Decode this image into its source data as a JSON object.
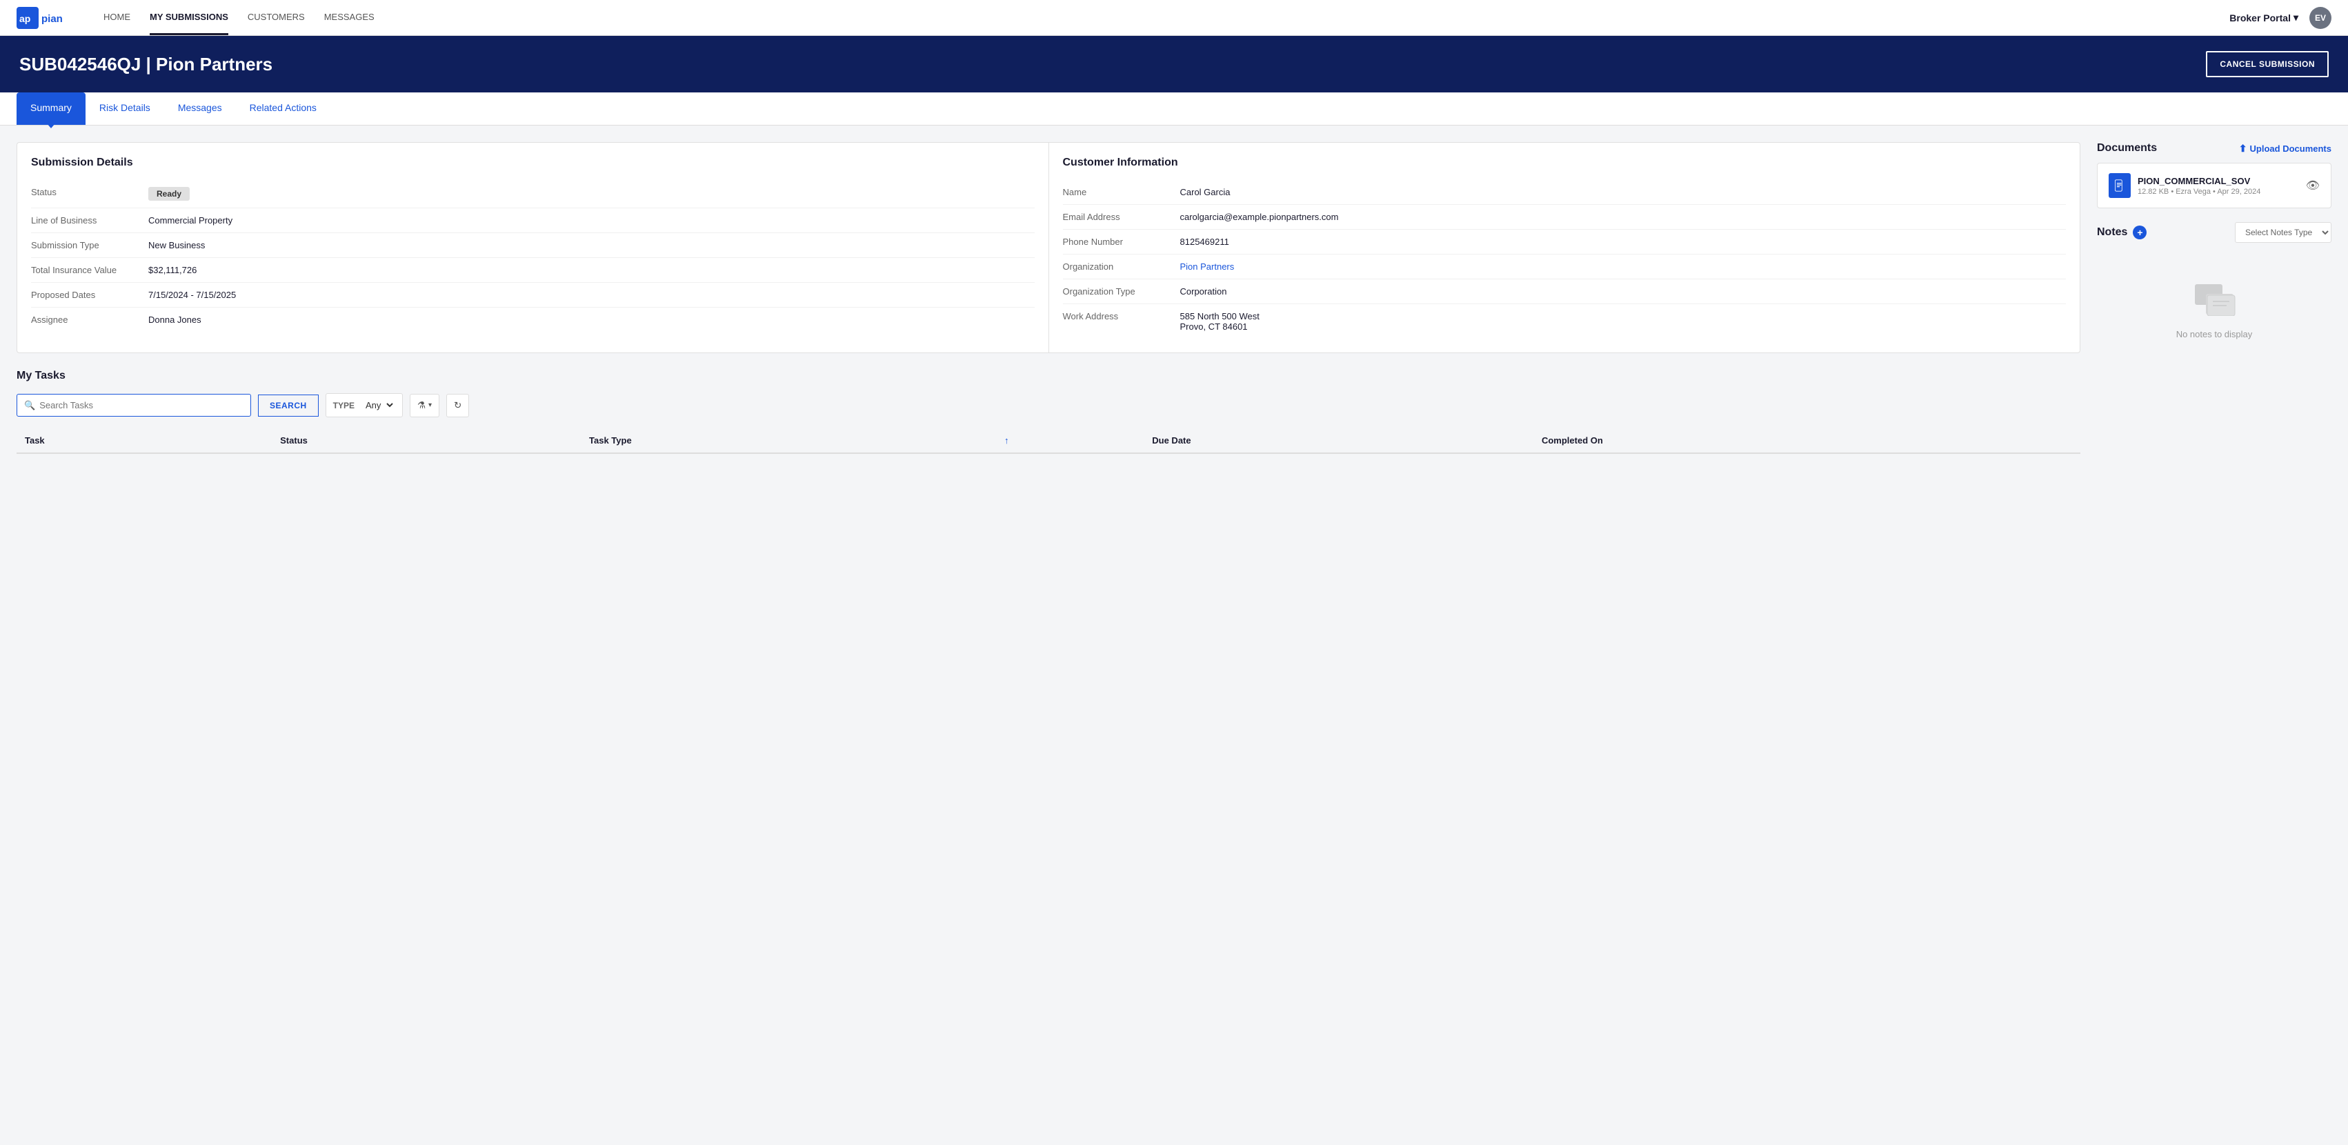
{
  "nav": {
    "logo_text": "appian",
    "links": [
      {
        "label": "HOME",
        "active": false,
        "id": "home"
      },
      {
        "label": "MY SUBMISSIONS",
        "active": true,
        "id": "my-submissions"
      },
      {
        "label": "CUSTOMERS",
        "active": false,
        "id": "customers"
      },
      {
        "label": "MESSAGES",
        "active": false,
        "id": "messages"
      }
    ],
    "broker_portal": "Broker Portal",
    "chevron": "▾",
    "avatar": "EV"
  },
  "header": {
    "title": "SUB042546QJ | Pion Partners",
    "cancel_button": "CANCEL SUBMISSION"
  },
  "tabs": [
    {
      "label": "Summary",
      "active": true,
      "id": "summary"
    },
    {
      "label": "Risk Details",
      "active": false,
      "id": "risk-details"
    },
    {
      "label": "Messages",
      "active": false,
      "id": "messages"
    },
    {
      "label": "Related Actions",
      "active": false,
      "id": "related-actions"
    }
  ],
  "submission_details": {
    "title": "Submission Details",
    "rows": [
      {
        "label": "Status",
        "value": "Ready",
        "is_badge": true
      },
      {
        "label": "Line of Business",
        "value": "Commercial Property"
      },
      {
        "label": "Submission Type",
        "value": "New Business"
      },
      {
        "label": "Total Insurance Value",
        "value": "$32,111,726"
      },
      {
        "label": "Proposed Dates",
        "value": "7/15/2024 - 7/15/2025"
      },
      {
        "label": "Assignee",
        "value": "Donna Jones"
      }
    ]
  },
  "customer_information": {
    "title": "Customer Information",
    "rows": [
      {
        "label": "Name",
        "value": "Carol Garcia",
        "is_link": false
      },
      {
        "label": "Email Address",
        "value": "carolgarcia@example.pionpartners.com",
        "is_link": false
      },
      {
        "label": "Phone Number",
        "value": "8125469211",
        "is_link": false
      },
      {
        "label": "Organization",
        "value": "Pion Partners",
        "is_link": true
      },
      {
        "label": "Organization Type",
        "value": "Corporation",
        "is_link": false
      },
      {
        "label": "Work Address",
        "value": "585 North 500 West\nProvo, CT 84601",
        "is_link": false
      }
    ]
  },
  "tasks": {
    "title": "My Tasks",
    "search_placeholder": "Search Tasks",
    "search_button": "SEARCH",
    "type_label": "TYPE",
    "type_value": "Any",
    "columns": [
      {
        "label": "Task",
        "sortable": false
      },
      {
        "label": "Status",
        "sortable": false
      },
      {
        "label": "Task Type",
        "sortable": false
      },
      {
        "label": "↑",
        "sortable": true
      },
      {
        "label": "Due Date",
        "sortable": false
      },
      {
        "label": "Completed On",
        "sortable": false
      }
    ]
  },
  "documents": {
    "title": "Documents",
    "upload_label": "Upload Documents",
    "items": [
      {
        "name": "PION_COMMERCIAL_SOV",
        "meta": "12.82 KB • Ezra Vega • Apr 29, 2024"
      }
    ]
  },
  "notes": {
    "title": "Notes",
    "add_label": "+",
    "select_placeholder": "Select Notes Type",
    "empty_message": "No notes to display"
  }
}
